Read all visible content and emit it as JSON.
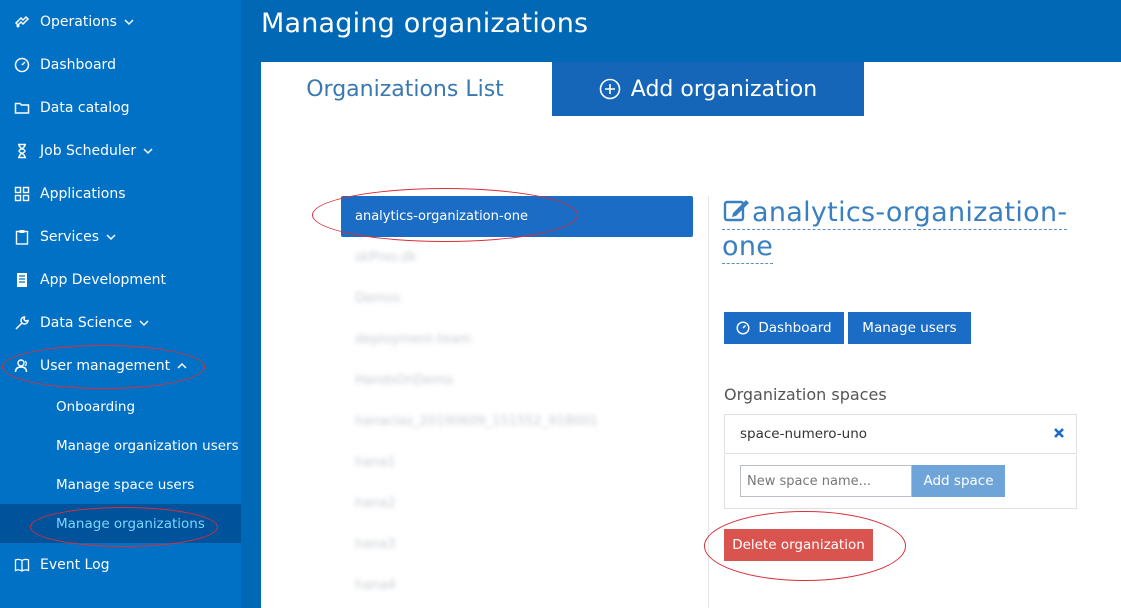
{
  "sidebar": {
    "items": [
      {
        "label": "Operations",
        "icon": "operations-icon",
        "chevron": "down"
      },
      {
        "label": "Dashboard",
        "icon": "dashboard-icon"
      },
      {
        "label": "Data catalog",
        "icon": "folder-icon"
      },
      {
        "label": "Job Scheduler",
        "icon": "hourglass-icon",
        "chevron": "down"
      },
      {
        "label": "Applications",
        "icon": "grid-icon"
      },
      {
        "label": "Services",
        "icon": "clipboard-icon",
        "chevron": "down"
      },
      {
        "label": "App Development",
        "icon": "server-icon"
      },
      {
        "label": "Data Science",
        "icon": "wrench-icon",
        "chevron": "down"
      },
      {
        "label": "User management",
        "icon": "users-icon",
        "chevron": "up"
      },
      {
        "label": "Event Log",
        "icon": "book-icon"
      }
    ],
    "user_management_children": [
      {
        "label": "Onboarding"
      },
      {
        "label": "Manage organization users"
      },
      {
        "label": "Manage space users"
      },
      {
        "label": "Manage organizations",
        "active": true
      }
    ]
  },
  "header": {
    "title": "Managing organizations"
  },
  "tabs": [
    {
      "label": "Organizations List",
      "active": true
    },
    {
      "label": "Add organization",
      "icon": "plus-circle-icon"
    }
  ],
  "organizations": [
    {
      "name": "analytics-organization-one",
      "selected": true
    },
    {
      "name": "skPrxo.dk",
      "blurred": true
    },
    {
      "name": "Demos",
      "blurred": true
    },
    {
      "name": "deployment-team",
      "blurred": true
    },
    {
      "name": "HandsOnDemo",
      "blurred": true
    },
    {
      "name": "hanaclas_20190609_151552_918001",
      "blurred": true
    },
    {
      "name": "hana1",
      "blurred": true
    },
    {
      "name": "hana2",
      "blurred": true
    },
    {
      "name": "hana3",
      "blurred": true
    },
    {
      "name": "hana4",
      "blurred": true
    }
  ],
  "detail": {
    "org_name_line1": "analytics-organization-",
    "org_name_line2": "one",
    "dashboard_label": "Dashboard",
    "manage_users_label": "Manage users",
    "spaces_label": "Organization spaces",
    "spaces": [
      {
        "name": "space-numero-uno"
      }
    ],
    "new_space_placeholder": "New space name...",
    "add_space_label": "Add space",
    "delete_label": "Delete organization"
  },
  "colors": {
    "sidebar_bg": "#0071c5",
    "header_bg": "#0068b5",
    "active_tab_text": "#3a78b0",
    "inactive_tab_bg": "#1565b8",
    "primary_button": "#1a6cc4",
    "add_space_button": "#6fa4d9",
    "danger_button": "#d9534f",
    "active_subitem_text": "#7ad6ff",
    "annotation_red": "#d8303a"
  }
}
